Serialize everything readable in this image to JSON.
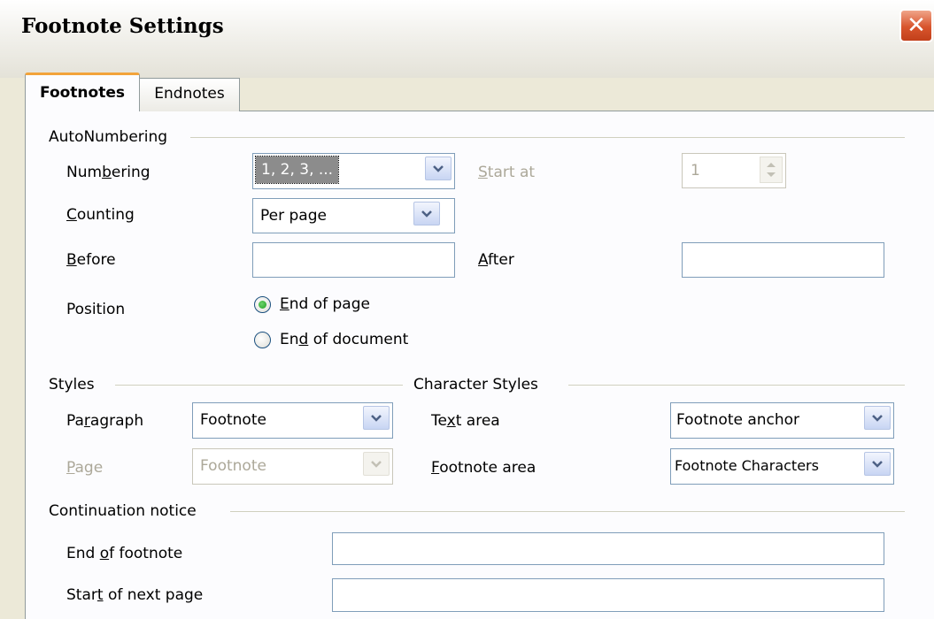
{
  "window": {
    "title": "Footnote Settings"
  },
  "tabs": [
    {
      "pre": "Footnotes",
      "accel": "",
      "post": ""
    },
    {
      "pre": "Endnotes",
      "accel": "",
      "post": ""
    }
  ],
  "autonumbering": {
    "group_label": "AutoNumbering",
    "numbering": {
      "pre": "Num",
      "accel": "b",
      "post": "ering",
      "value": "1, 2, 3, ..."
    },
    "start_at": {
      "pre": "",
      "accel": "S",
      "post": "tart at",
      "value": "1"
    },
    "counting": {
      "pre": "",
      "accel": "C",
      "post": "ounting",
      "value": "Per page"
    },
    "before": {
      "pre": "",
      "accel": "B",
      "post": "efore",
      "value": ""
    },
    "after": {
      "pre": "",
      "accel": "A",
      "post": "fter",
      "value": ""
    },
    "position": {
      "label": "Position",
      "end_of_page": {
        "pre": "",
        "accel": "E",
        "post": "nd of page",
        "selected": true
      },
      "end_of_document": {
        "pre": "En",
        "accel": "d",
        "post": " of document",
        "selected": false
      }
    }
  },
  "styles": {
    "group_label": "Styles",
    "paragraph": {
      "pre": "Pa",
      "accel": "r",
      "post": "agraph",
      "value": "Footnote"
    },
    "page": {
      "pre": "",
      "accel": "P",
      "post": "age",
      "value": "Footnote"
    }
  },
  "character_styles": {
    "group_label": "Character Styles",
    "text_area": {
      "pre": "Te",
      "accel": "x",
      "post": "t area",
      "value": "Footnote anchor"
    },
    "footnote_area": {
      "pre": "",
      "accel": "F",
      "post": "ootnote area",
      "value": "Footnote Characters"
    }
  },
  "continuation": {
    "group_label": "Continuation notice",
    "end_of_footnote": {
      "pre": "End ",
      "accel": "o",
      "post": "f footnote",
      "value": ""
    },
    "start_of_next_page": {
      "pre": "Star",
      "accel": "t",
      "post": " of next page",
      "value": ""
    }
  },
  "colors": {
    "accent_tab": "#f2a33a",
    "close_button": "#d8542c",
    "field_border": "#7f9db9"
  }
}
